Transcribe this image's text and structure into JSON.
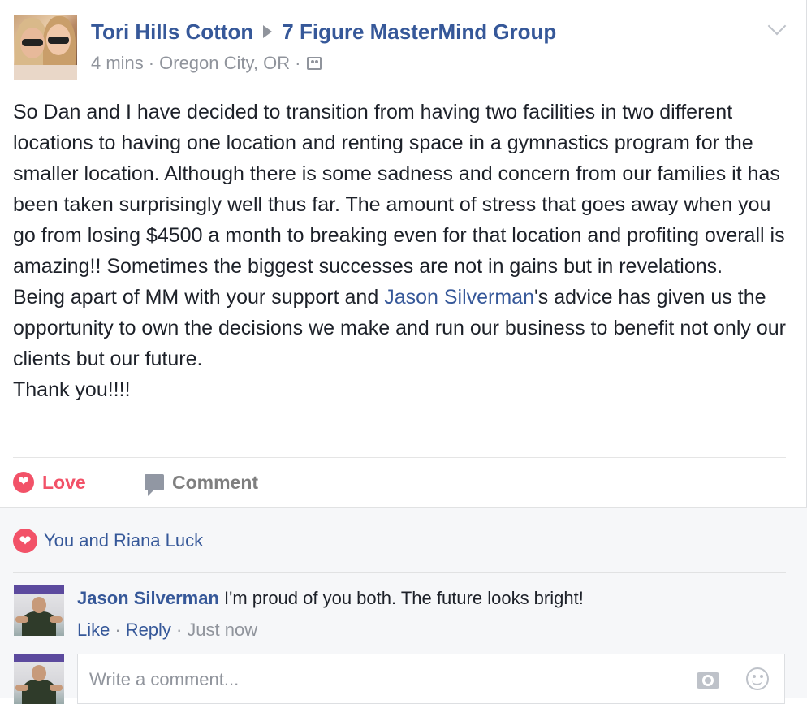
{
  "post": {
    "author": "Tori Hills Cotton",
    "group": "7 Figure MasterMind Group",
    "time": "4 mins",
    "separator": "·",
    "location": "Oregon City, OR",
    "audience_icon": "group-audience-icon",
    "body": {
      "paragraph1": "So Dan and I have decided to transition from having two facilities in two different locations to having one location and renting space in a gymnastics program for the smaller location. Although there is some sadness and concern from our families it has been taken surprisingly well thus far. The amount of stress that goes away when you go from losing $4500 a month to breaking even for that location and profiting overall is amazing!! Sometimes the biggest successes are not in gains but in revelations.",
      "line2_before": "Being apart of MM with your support and ",
      "mention": "Jason Silverman",
      "line2_after": "'s advice has given us the opportunity to own the decisions we make and run our business to benefit not only our clients but our future.",
      "closing": "Thank you!!!!"
    }
  },
  "actions": {
    "love_label": "Love",
    "comment_label": "Comment"
  },
  "reactions": {
    "summary": "You and Riana Luck"
  },
  "comments": [
    {
      "author": "Jason Silverman",
      "text": "I'm proud of you both. The future looks bright!",
      "like_label": "Like",
      "reply_label": "Reply",
      "time": "Just now"
    }
  ],
  "composer": {
    "placeholder": "Write a comment..."
  },
  "colors": {
    "link": "#365899",
    "love": "#f25268",
    "meta": "#90949c"
  }
}
